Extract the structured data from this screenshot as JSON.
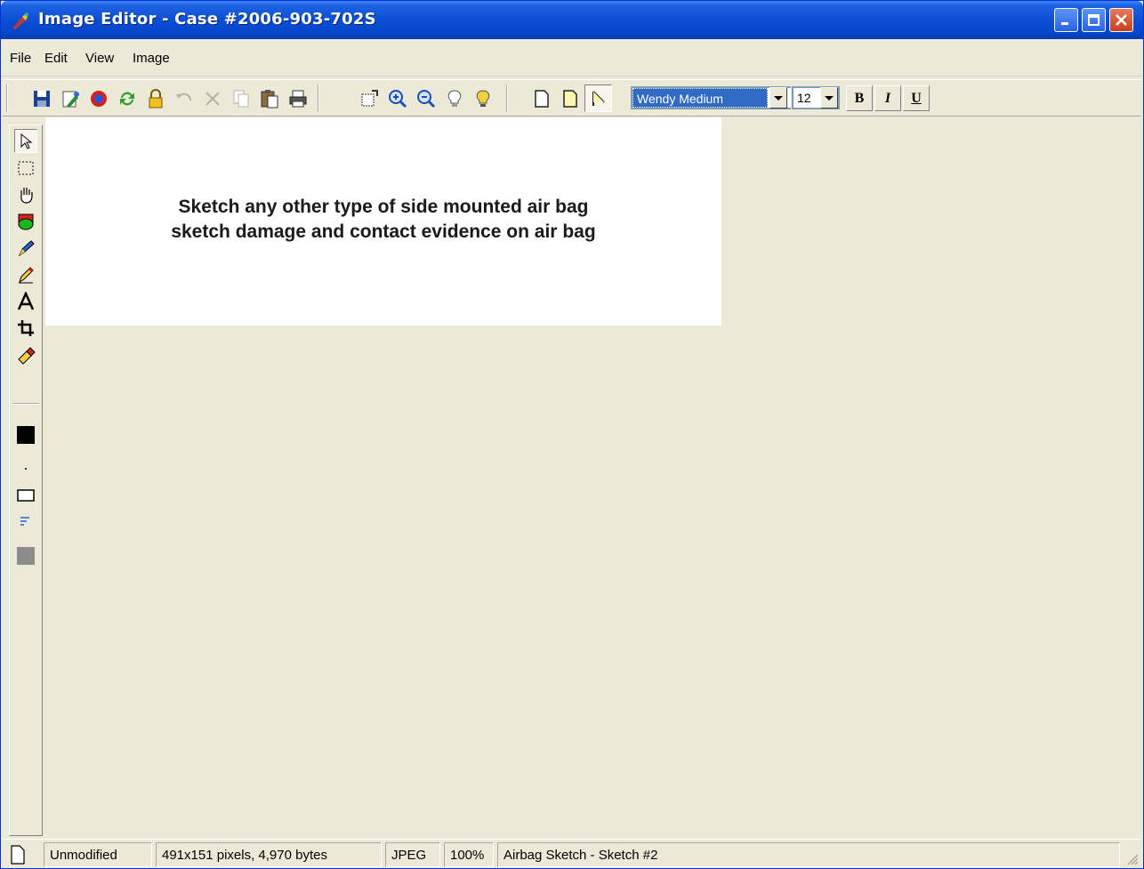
{
  "window": {
    "title": "Image Editor - Case #2006-903-702S",
    "controls": [
      "minimize",
      "maximize",
      "close"
    ]
  },
  "menu": [
    "File",
    "Edit",
    "View",
    "Image"
  ],
  "toolbar": {
    "tools": [
      {
        "name": "save-icon"
      },
      {
        "name": "import-icon"
      },
      {
        "name": "rotate-icon"
      },
      {
        "name": "refresh-icon"
      },
      {
        "name": "lock-icon"
      },
      {
        "name": "undo-icon"
      },
      {
        "name": "delete-icon"
      },
      {
        "name": "copy-icon"
      },
      {
        "name": "paste-icon"
      },
      {
        "name": "print-icon"
      },
      {
        "name": "fit-icon"
      },
      {
        "name": "zoom-in-icon"
      },
      {
        "name": "zoom-out-icon"
      },
      {
        "name": "light-off-icon"
      },
      {
        "name": "light-on-icon"
      },
      {
        "name": "page-icon"
      },
      {
        "name": "page-yellow-icon"
      },
      {
        "name": "page-corner-icon"
      }
    ],
    "font_name": "Wendy Medium",
    "font_size": "12",
    "bold_label": "B",
    "italic_label": "I",
    "underline_label": "U"
  },
  "palette": [
    "pointer-icon",
    "select-rect-icon",
    "hand-icon",
    "shape-icon",
    "pen-icon",
    "pencil-icon",
    "text-icon",
    "crop-icon",
    "eraser-icon",
    "color-black-swatch",
    "dot-size-icon",
    "rect-outline-icon",
    "align-icon",
    "color-gray-swatch"
  ],
  "canvas": {
    "line1": "Sketch any other type of side mounted air bag",
    "line2": "sketch damage and contact evidence on air bag"
  },
  "status": {
    "state": "Unmodified",
    "dimensions": "491x151 pixels, 4,970 bytes",
    "format": "JPEG",
    "zoom": "100%",
    "document": "Airbag Sketch - Sketch #2"
  },
  "colors": {
    "titlebar": "#0a4fd6",
    "face": "#ece9d8",
    "selection": "#316ac5"
  }
}
